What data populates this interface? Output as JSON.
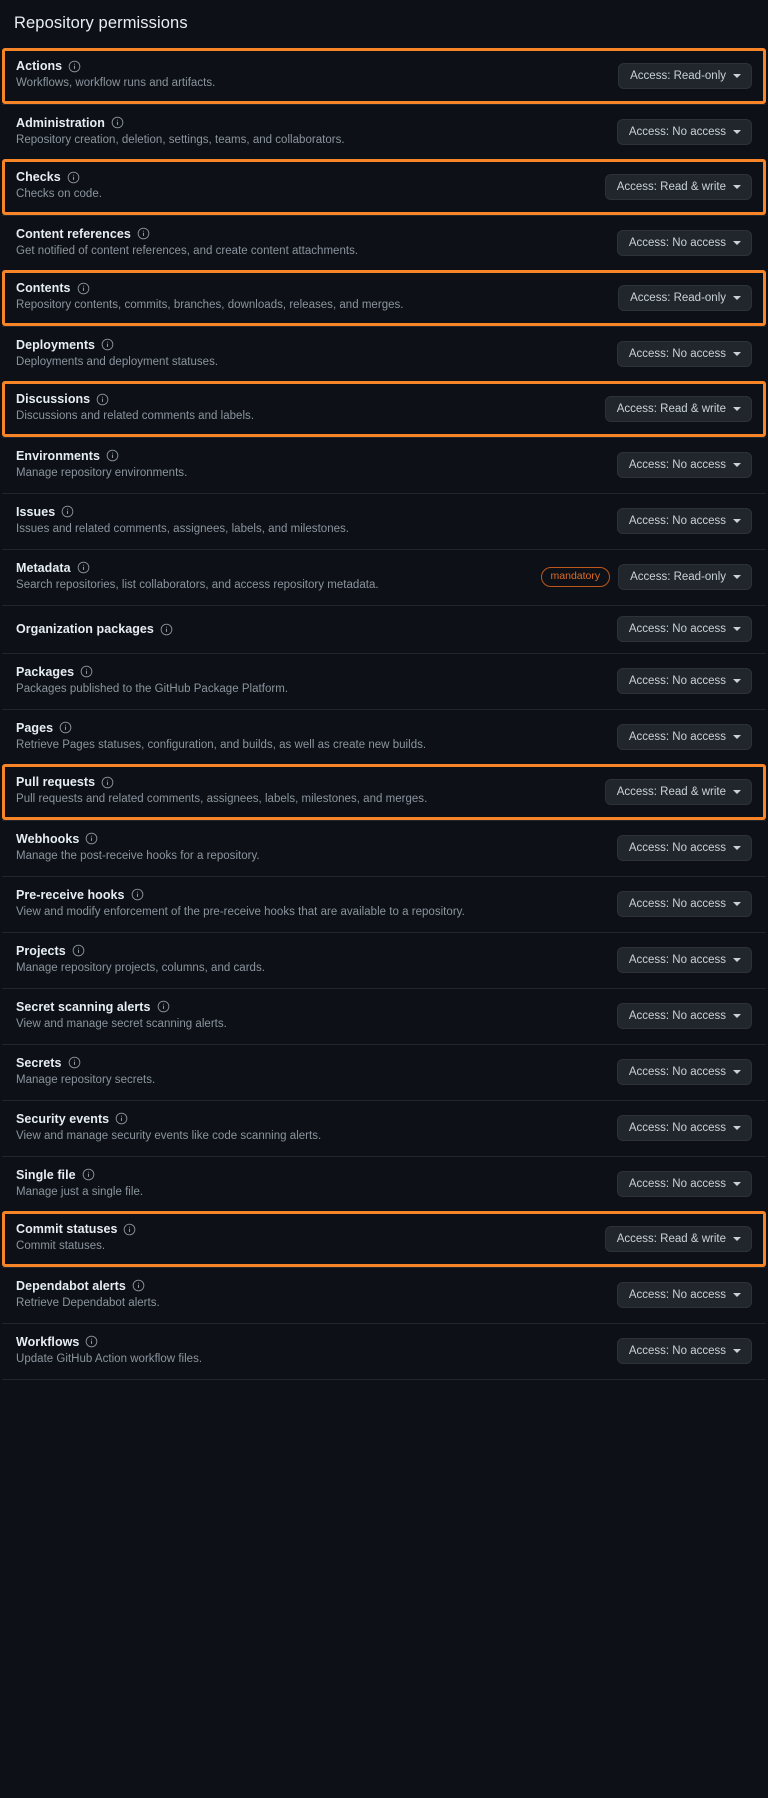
{
  "page": {
    "title": "Repository permissions",
    "info_icon": "info-icon",
    "caret_icon": "chevron-down-icon"
  },
  "labels": {
    "mandatory_badge": "mandatory",
    "access_prefix": "Access:"
  },
  "access_options": [
    "No access",
    "Read-only",
    "Read & write"
  ],
  "permissions": [
    {
      "name": "Actions",
      "description": "Workflows, workflow runs and artifacts.",
      "access": "Access: Read-only",
      "highlighted": true,
      "mandatory": false
    },
    {
      "name": "Administration",
      "description": "Repository creation, deletion, settings, teams, and collaborators.",
      "access": "Access: No access",
      "highlighted": false,
      "mandatory": false
    },
    {
      "name": "Checks",
      "description": "Checks on code.",
      "access": "Access: Read & write",
      "highlighted": true,
      "mandatory": false
    },
    {
      "name": "Content references",
      "description": "Get notified of content references, and create content attachments.",
      "access": "Access: No access",
      "highlighted": false,
      "mandatory": false
    },
    {
      "name": "Contents",
      "description": "Repository contents, commits, branches, downloads, releases, and merges.",
      "access": "Access: Read-only",
      "highlighted": true,
      "mandatory": false
    },
    {
      "name": "Deployments",
      "description": "Deployments and deployment statuses.",
      "access": "Access: No access",
      "highlighted": false,
      "mandatory": false
    },
    {
      "name": "Discussions",
      "description": "Discussions and related comments and labels.",
      "access": "Access: Read & write",
      "highlighted": true,
      "mandatory": false
    },
    {
      "name": "Environments",
      "description": "Manage repository environments.",
      "access": "Access: No access",
      "highlighted": false,
      "mandatory": false
    },
    {
      "name": "Issues",
      "description": "Issues and related comments, assignees, labels, and milestones.",
      "access": "Access: No access",
      "highlighted": false,
      "mandatory": false
    },
    {
      "name": "Metadata",
      "description": "Search repositories, list collaborators, and access repository metadata.",
      "access": "Access: Read-only",
      "highlighted": false,
      "mandatory": true
    },
    {
      "name": "Organization packages",
      "description": "",
      "access": "Access: No access",
      "highlighted": false,
      "mandatory": false
    },
    {
      "name": "Packages",
      "description": "Packages published to the GitHub Package Platform.",
      "access": "Access: No access",
      "highlighted": false,
      "mandatory": false
    },
    {
      "name": "Pages",
      "description": "Retrieve Pages statuses, configuration, and builds, as well as create new builds.",
      "access": "Access: No access",
      "highlighted": false,
      "mandatory": false
    },
    {
      "name": "Pull requests",
      "description": "Pull requests and related comments, assignees, labels, milestones, and merges.",
      "access": "Access: Read & write",
      "highlighted": true,
      "mandatory": false
    },
    {
      "name": "Webhooks",
      "description": "Manage the post-receive hooks for a repository.",
      "access": "Access: No access",
      "highlighted": false,
      "mandatory": false
    },
    {
      "name": "Pre-receive hooks",
      "description": "View and modify enforcement of the pre-receive hooks that are available to a repository.",
      "access": "Access: No access",
      "highlighted": false,
      "mandatory": false
    },
    {
      "name": "Projects",
      "description": "Manage repository projects, columns, and cards.",
      "access": "Access: No access",
      "highlighted": false,
      "mandatory": false
    },
    {
      "name": "Secret scanning alerts",
      "description": "View and manage secret scanning alerts.",
      "access": "Access: No access",
      "highlighted": false,
      "mandatory": false
    },
    {
      "name": "Secrets",
      "description": "Manage repository secrets.",
      "access": "Access: No access",
      "highlighted": false,
      "mandatory": false
    },
    {
      "name": "Security events",
      "description": "View and manage security events like code scanning alerts.",
      "access": "Access: No access",
      "highlighted": false,
      "mandatory": false
    },
    {
      "name": "Single file",
      "description": "Manage just a single file.",
      "access": "Access: No access",
      "highlighted": false,
      "mandatory": false
    },
    {
      "name": "Commit statuses",
      "description": "Commit statuses.",
      "access": "Access: Read & write",
      "highlighted": true,
      "mandatory": false
    },
    {
      "name": "Dependabot alerts",
      "description": "Retrieve Dependabot alerts.",
      "access": "Access: No access",
      "highlighted": false,
      "mandatory": false
    },
    {
      "name": "Workflows",
      "description": "Update GitHub Action workflow files.",
      "access": "Access: No access",
      "highlighted": false,
      "mandatory": false
    }
  ],
  "colors": {
    "background": "#0d1117",
    "highlight_border": "#f78528",
    "mandatory_text": "#db6d28",
    "mandatory_border": "#bd561d",
    "button_background": "#21262d",
    "text_primary": "#e6edf3",
    "text_secondary": "#8b949e",
    "divider": "#21262d"
  }
}
